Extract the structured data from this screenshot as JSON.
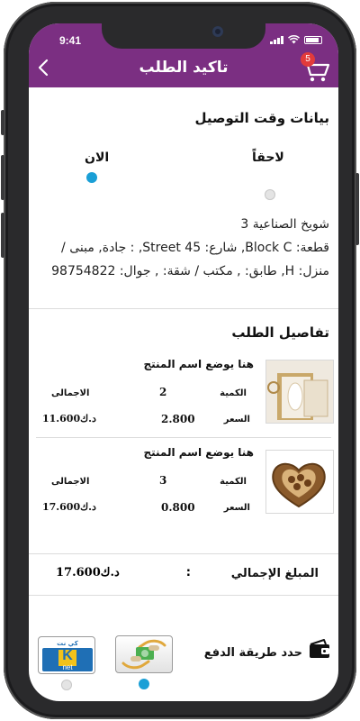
{
  "status_bar": {
    "time": "9:41"
  },
  "header": {
    "title": "تاكيد الطلب",
    "cart_count": "5"
  },
  "delivery": {
    "title": "بيانات وقت التوصيل",
    "options": [
      {
        "label": "الان",
        "selected": true
      },
      {
        "label": "لاحقاً",
        "selected": false
      }
    ],
    "address_lines": [
      "شويخ الصناعية 3",
      "قطعة: Block C, شارع: Street 45, : جادة, مبنى /",
      "منزل: H, طابق: , مكتب / شقة: , جوال: 98754822"
    ]
  },
  "order": {
    "title": "تفاصيل الطلب",
    "labels": {
      "quantity": "الكمية",
      "price": "السعر",
      "total": "الاجمالى"
    },
    "items": [
      {
        "name": "هنا يوضع اسم المنتج",
        "quantity": "2",
        "price": "2.800",
        "total": "11.600د.ك",
        "image": "wedding-card-image"
      },
      {
        "name": "هنا يوضع اسم المنتج",
        "quantity": "3",
        "price": "0.800",
        "total": "17.600د.ك",
        "image": "heart-chocolate-box-image"
      }
    ]
  },
  "summary": {
    "label": "المبلغ الإجمالي",
    "colon": ":",
    "value": "17.600د.ك"
  },
  "payment": {
    "title": "حدد طريقة الدفع",
    "methods": [
      {
        "name": "cash-payment",
        "selected": true
      },
      {
        "name": "knet-payment",
        "text_top": "كي نت",
        "text_letter": "K",
        "text_bottom": "net",
        "selected": false
      }
    ]
  },
  "colors": {
    "header": "#7b2f82",
    "radio_on": "#1a9fd6",
    "badge": "#e23b3b"
  }
}
